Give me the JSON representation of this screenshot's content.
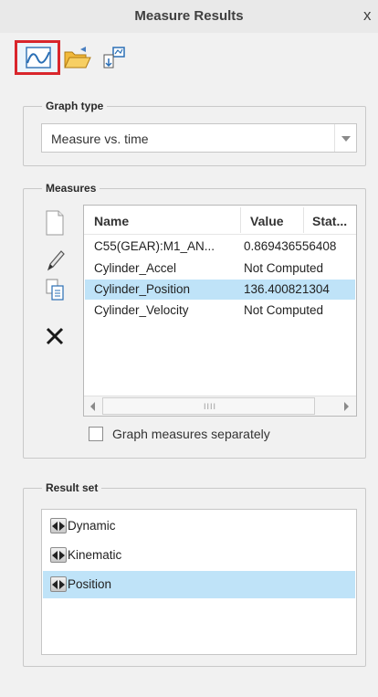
{
  "window": {
    "title": "Measure Results",
    "close_glyph": "x"
  },
  "toolbar": {
    "items": [
      {
        "name": "graph-icon",
        "active": true
      },
      {
        "name": "open-folder-icon",
        "active": false
      },
      {
        "name": "export-icon",
        "active": false
      }
    ],
    "active_border_color": "#d9262c"
  },
  "graph_type": {
    "legend": "Graph type",
    "selected": "Measure vs. time"
  },
  "measures": {
    "legend": "Measures",
    "side_tools": [
      "new-measure-icon",
      "edit-pencil-icon",
      "copy-icon",
      "delete-icon"
    ],
    "columns": [
      "Name",
      "Value",
      "Stat..."
    ],
    "rows": [
      {
        "name": "C55(GEAR):M1_AN...",
        "value": "0.869436556408",
        "selected": false
      },
      {
        "name": "Cylinder_Accel",
        "value": "Not Computed",
        "selected": false
      },
      {
        "name": "Cylinder_Position",
        "value": "136.400821304",
        "selected": true
      },
      {
        "name": "Cylinder_Velocity",
        "value": "Not Computed",
        "selected": false
      }
    ],
    "scroll_grip": "IIII",
    "graph_separately_label": "Graph measures separately",
    "graph_separately_checked": false
  },
  "result_set": {
    "legend": "Result set",
    "items": [
      {
        "label": "Dynamic",
        "selected": false
      },
      {
        "label": "Kinematic",
        "selected": false
      },
      {
        "label": "Position",
        "selected": true
      }
    ]
  },
  "colors": {
    "selection": "#bfe3f8",
    "panel_bg": "#f1f1f1"
  }
}
